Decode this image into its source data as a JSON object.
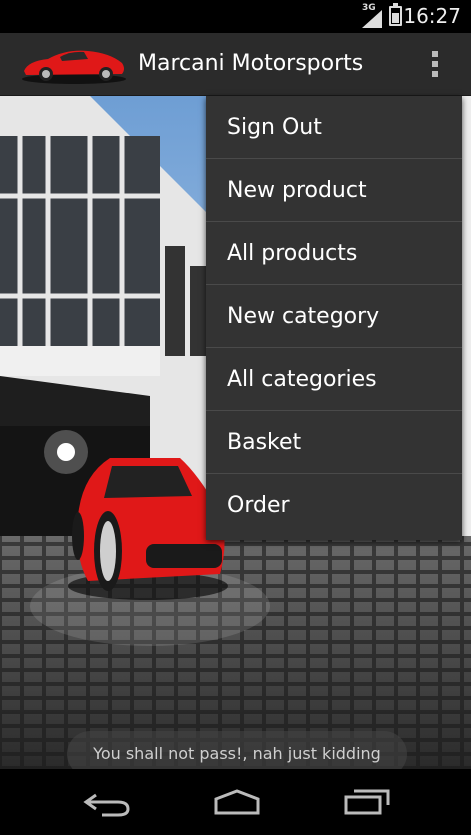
{
  "status_bar": {
    "network": "3G",
    "time": "16:27"
  },
  "action_bar": {
    "title": "Marcani Motorsports",
    "overflow_icon": "more-vert-icon",
    "logo_icon": "red-sports-car-logo"
  },
  "menu": {
    "items": [
      {
        "label": "Sign Out"
      },
      {
        "label": "New product"
      },
      {
        "label": "All products"
      },
      {
        "label": "New category"
      },
      {
        "label": "All categories"
      },
      {
        "label": "Basket"
      },
      {
        "label": "Order"
      }
    ]
  },
  "toast": {
    "text": "You shall not pass!, nah just kidding"
  },
  "nav_bar": {
    "back_icon": "back-icon",
    "home_icon": "home-icon",
    "recents_icon": "recents-icon"
  },
  "colors": {
    "action_bar_bg": "#2b2b2b",
    "menu_bg": "#333333",
    "car_red": "#e01818"
  }
}
